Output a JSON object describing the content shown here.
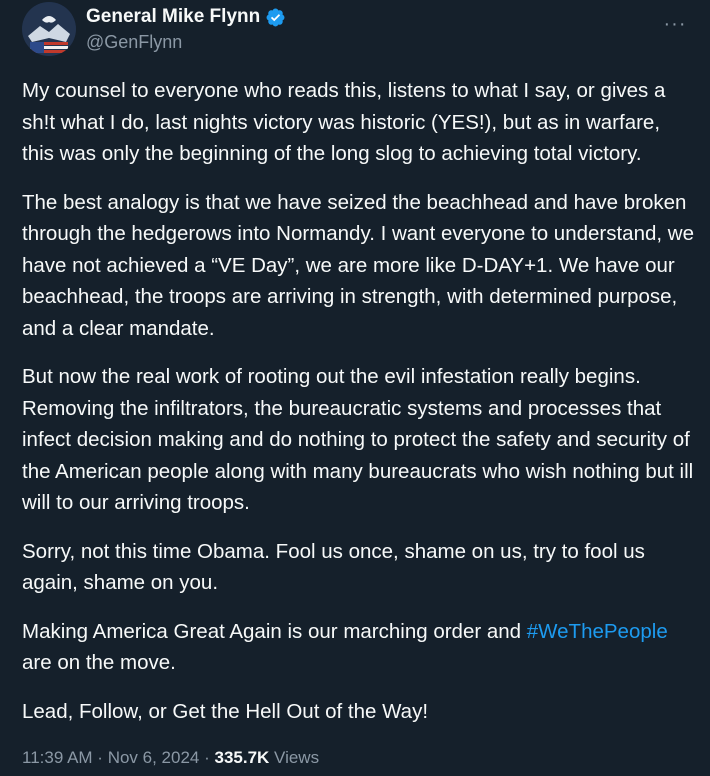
{
  "author": {
    "display_name": "General Mike Flynn",
    "handle": "@GenFlynn",
    "verified": true,
    "avatar_icon": "eagle-flag-avatar"
  },
  "menu": {
    "more_label": "···"
  },
  "tweet": {
    "paragraphs": [
      "My counsel to everyone who reads this, listens to what I say, or gives a sh!t what I do, last nights victory was historic (YES!), but as in warfare, this was only the beginning of the long slog to achieving total victory.",
      "The best analogy is that we have seized the beachhead and have broken through the hedgerows into Normandy.  I want everyone to understand, we have not achieved a “VE Day”, we are more like D-DAY+1. We have our beachhead, the troops are arriving in strength, with determined purpose, and a clear mandate.",
      "But now the real work of rooting out the evil infestation really begins. Removing the infiltrators, the bureaucratic systems and processes that infect decision making and do nothing to protect the safety and security of the American people along with many bureaucrats who wish nothing but ill will to our arriving troops.",
      "Sorry, not this time Obama. Fool us once, shame on us, try to fool us again, shame on you."
    ],
    "para5_before": "Making America Great Again is our marching order and ",
    "hashtag": "#WeThePeople",
    "para5_after": " are on the move.",
    "para6": "Lead, Follow, or Get the Hell Out of the Way!"
  },
  "meta": {
    "time": "11:39 AM",
    "separator": " · ",
    "date": "Nov 6, 2024",
    "views_count": "335.7K",
    "views_label": " Views"
  },
  "colors": {
    "background": "#15202b",
    "text": "#f7f9f9",
    "secondary": "#8b98a5",
    "link": "#1d9bf0"
  }
}
